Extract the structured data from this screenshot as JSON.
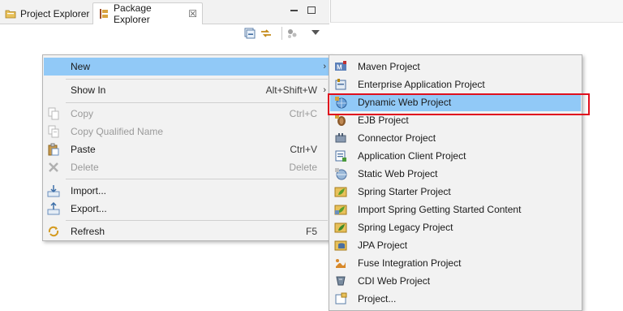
{
  "tabs": [
    {
      "label": "Project Explorer",
      "icon": "project-explorer-icon"
    },
    {
      "label": "Package Explorer",
      "icon": "package-explorer-icon",
      "close": "☒"
    }
  ],
  "toolbar_icons": [
    "collapse-all-icon",
    "link-with-editor-icon",
    "focus-icon",
    "view-menu-icon"
  ],
  "context_menu": {
    "new": {
      "label": "New",
      "arrow": "›"
    },
    "show_in": {
      "label": "Show In",
      "accel": "Alt+Shift+W",
      "arrow": "›"
    },
    "copy": {
      "label": "Copy",
      "accel": "Ctrl+C"
    },
    "copy_qualified": {
      "label": "Copy Qualified Name"
    },
    "paste": {
      "label": "Paste",
      "accel": "Ctrl+V"
    },
    "delete": {
      "label": "Delete",
      "accel": "Delete"
    },
    "import": {
      "label": "Import..."
    },
    "export": {
      "label": "Export..."
    },
    "refresh": {
      "label": "Refresh",
      "accel": "F5"
    }
  },
  "new_submenu": [
    {
      "label": "Maven Project",
      "icon": "maven-project-icon"
    },
    {
      "label": "Enterprise Application Project",
      "icon": "enterprise-app-icon"
    },
    {
      "label": "Dynamic Web Project",
      "icon": "dynamic-web-project-icon",
      "highlighted": true
    },
    {
      "label": "EJB Project",
      "icon": "ejb-project-icon"
    },
    {
      "label": "Connector Project",
      "icon": "connector-project-icon"
    },
    {
      "label": "Application Client Project",
      "icon": "app-client-project-icon"
    },
    {
      "label": "Static Web Project",
      "icon": "static-web-project-icon"
    },
    {
      "label": "Spring Starter Project",
      "icon": "spring-starter-icon"
    },
    {
      "label": "Import Spring Getting Started Content",
      "icon": "spring-import-icon"
    },
    {
      "label": "Spring Legacy Project",
      "icon": "spring-legacy-icon"
    },
    {
      "label": "JPA Project",
      "icon": "jpa-project-icon"
    },
    {
      "label": "Fuse Integration Project",
      "icon": "fuse-project-icon"
    },
    {
      "label": "CDI Web Project",
      "icon": "cdi-web-project-icon"
    },
    {
      "label": "Project...",
      "icon": "generic-project-icon"
    }
  ],
  "colors": {
    "highlight": "#91c9f7",
    "annotation_box": "#e0101e",
    "menu_bg": "#f2f2f2"
  }
}
